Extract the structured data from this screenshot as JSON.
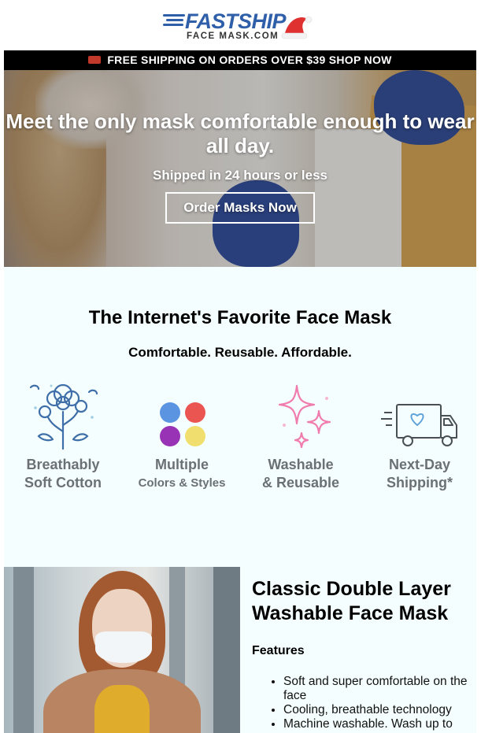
{
  "brand": {
    "name": "FASTSHIP",
    "subtitle": "FACE MASK.COM"
  },
  "shipping_bar": {
    "text": "FREE SHIPPING ON ORDERS OVER $39 SHOP NOW"
  },
  "hero": {
    "title": "Meet the only mask comfortable enough to wear all day.",
    "subtitle": "Shipped in 24 hours or less",
    "button": "Order Masks Now"
  },
  "favorite": {
    "title": "The Internet's Favorite Face Mask",
    "tagline": "Comfortable. Reusable. Affordable.",
    "features": [
      {
        "line1": "Breathably",
        "line2": "Soft Cotton",
        "icon": "cotton-plant-icon"
      },
      {
        "line1": "Multiple",
        "line2": "Colors & Styles",
        "icon": "color-dots-icon"
      },
      {
        "line1": "Washable",
        "line2": "& Reusable",
        "icon": "sparkles-icon"
      },
      {
        "line1": "Next-Day",
        "line2": "Shipping*",
        "icon": "delivery-truck-icon"
      }
    ],
    "dot_colors": [
      "#5b94e0",
      "#ea5552",
      "#9933b5",
      "#f0df6e"
    ]
  },
  "product": {
    "title": "Classic Double Layer Washable Face Mask",
    "features_heading": "Features",
    "features": [
      "Soft and super comfortable on the face",
      "Cooling, breathable technology",
      "Machine washable. Wash up to"
    ]
  },
  "colors": {
    "brand_blue": "#2f5fa8",
    "shipping_bar_bg": "#000000",
    "feature_label": "#6b7075",
    "page_bg": "#f5fefe"
  }
}
